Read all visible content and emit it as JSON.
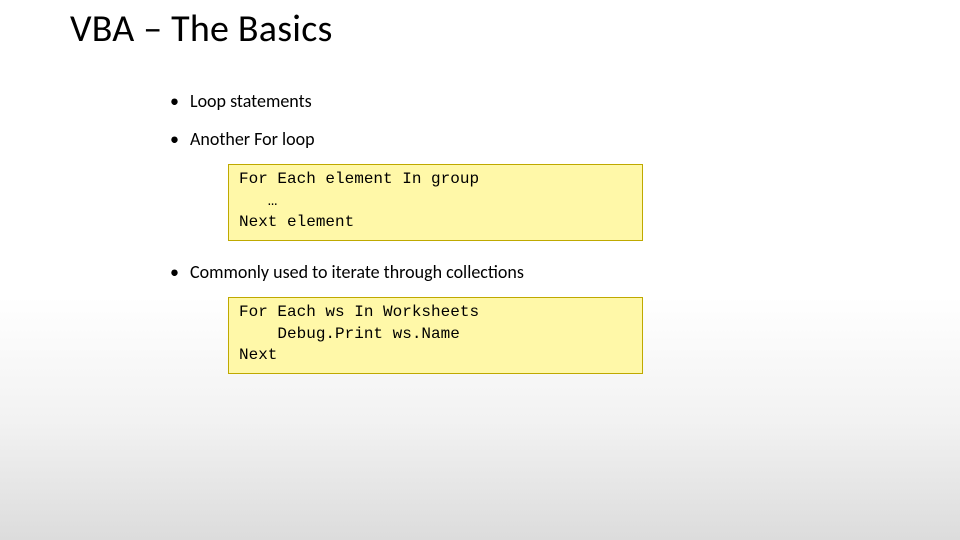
{
  "title": "VBA – The Basics",
  "bullets": {
    "b1": "Loop statements",
    "b2": "Another For loop",
    "b3": "Commonly used to iterate through collections"
  },
  "code1": "For Each element In group\n   …\nNext element",
  "code2": "For Each ws In Worksheets\n    Debug.Print ws.Name\nNext"
}
